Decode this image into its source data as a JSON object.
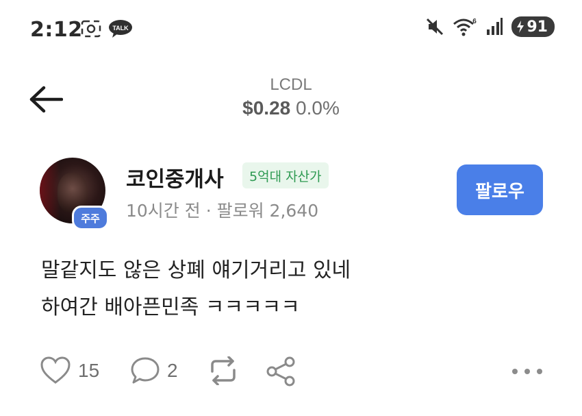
{
  "status_bar": {
    "time": "2:12",
    "talk_label": "TALK",
    "wifi_badge": "6",
    "battery_level": "91"
  },
  "header": {
    "ticker": "LCDL",
    "price": "$0.28",
    "change": "0.0%"
  },
  "post": {
    "author_name": "코인중개사",
    "asset_tag": "5억대 자산가",
    "holder_badge": "주주",
    "meta": "10시간 전 · 팔로워 2,640",
    "follow_label": "팔로우",
    "lines": [
      "말같지도 않은 상폐 얘기거리고 있네",
      "하여간 배아픈민족 ㅋㅋㅋㅋㅋ"
    ],
    "like_count": "15",
    "comment_count": "2"
  },
  "icons": [
    "camera-icon",
    "kakaotalk-icon",
    "mute-icon",
    "wifi-icon",
    "signal-icon",
    "battery-icon",
    "back-arrow-icon",
    "heart-icon",
    "comment-icon",
    "repost-icon",
    "share-icon",
    "more-icon"
  ]
}
